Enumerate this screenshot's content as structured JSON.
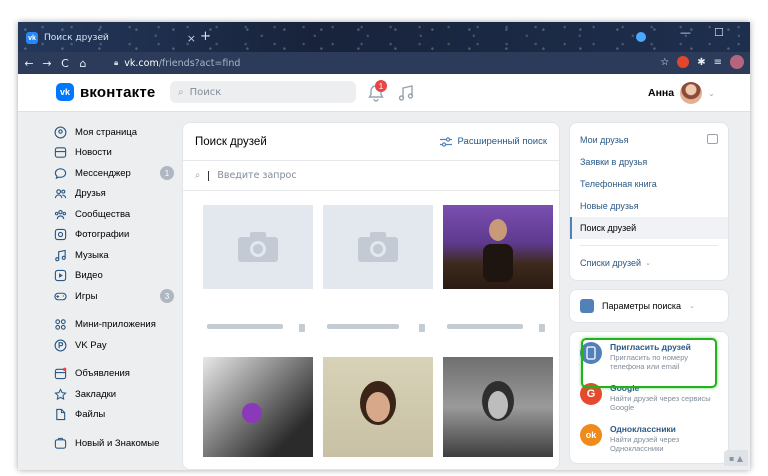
{
  "browser": {
    "tab_title": "Поиск друзей",
    "tab_close": "×",
    "new_tab": "+",
    "minimize": "—",
    "maximize": "☐",
    "url_host": "vk.com",
    "url_path": "/friends?act=find",
    "nav": {
      "back": "←",
      "forward": "→",
      "reload": "C",
      "home": "⌂"
    },
    "right_icons": [
      "star-icon",
      "extension-icon",
      "puzzle-icon",
      "reading-list-icon",
      "profile-icon"
    ]
  },
  "vk": {
    "logo_mark": "vk",
    "logo_word": "вконтакте",
    "search_placeholder": "Поиск",
    "notification_count": "1",
    "user_name": "Анна",
    "user_caret": "⌄"
  },
  "sidebar": {
    "items": [
      {
        "label": "Моя страница",
        "icon": "profile-icon"
      },
      {
        "label": "Новости",
        "icon": "news-icon"
      },
      {
        "label": "Мессенджер",
        "icon": "message-icon",
        "count": "1"
      },
      {
        "label": "Друзья",
        "icon": "friends-icon"
      },
      {
        "label": "Сообщества",
        "icon": "groups-icon"
      },
      {
        "label": "Фотографии",
        "icon": "photo-icon"
      },
      {
        "label": "Музыка",
        "icon": "music-icon"
      },
      {
        "label": "Видео",
        "icon": "video-icon"
      },
      {
        "label": "Игры",
        "icon": "gamepad-icon",
        "count": "3"
      },
      {
        "label": "Мини-приложения",
        "icon": "apps-icon"
      },
      {
        "label": "VK Pay",
        "icon": "vkpay-icon"
      },
      {
        "label": "Объявления",
        "icon": "ads-icon"
      },
      {
        "label": "Закладки",
        "icon": "star-icon"
      },
      {
        "label": "Файлы",
        "icon": "file-icon"
      },
      {
        "label": "Новый и Знакомые",
        "icon": "dating-icon"
      }
    ]
  },
  "main": {
    "title": "Поиск друзей",
    "advanced_search": "Расширенный поиск",
    "search_placeholder": "Введите запрос"
  },
  "right": {
    "menu": [
      {
        "label": "Мои друзья"
      },
      {
        "label": "Заявки в друзья"
      },
      {
        "label": "Телефонная книга"
      },
      {
        "label": "Новые друзья"
      },
      {
        "label": "Поиск друзей",
        "active": true
      }
    ],
    "friend_lists": "Списки друзей",
    "search_params": "Параметры поиска",
    "dropdown_caret": "⌄",
    "invite": {
      "title": "Пригласить друзей",
      "desc": "Пригласить по номеру телефона или email"
    },
    "google": {
      "title": "Google",
      "desc": "Найти друзей через сервисы Google",
      "icon_letter": "G"
    },
    "ok": {
      "title": "Одноклассники",
      "desc": "Найти друзей через Одноклассники",
      "icon_letter": "ok"
    },
    "colors": {
      "highlight": "#21b21c",
      "google": "#e64a2e",
      "ok": "#f08a1b",
      "vk_blue": "#0077ff",
      "link": "#2a5885"
    }
  }
}
